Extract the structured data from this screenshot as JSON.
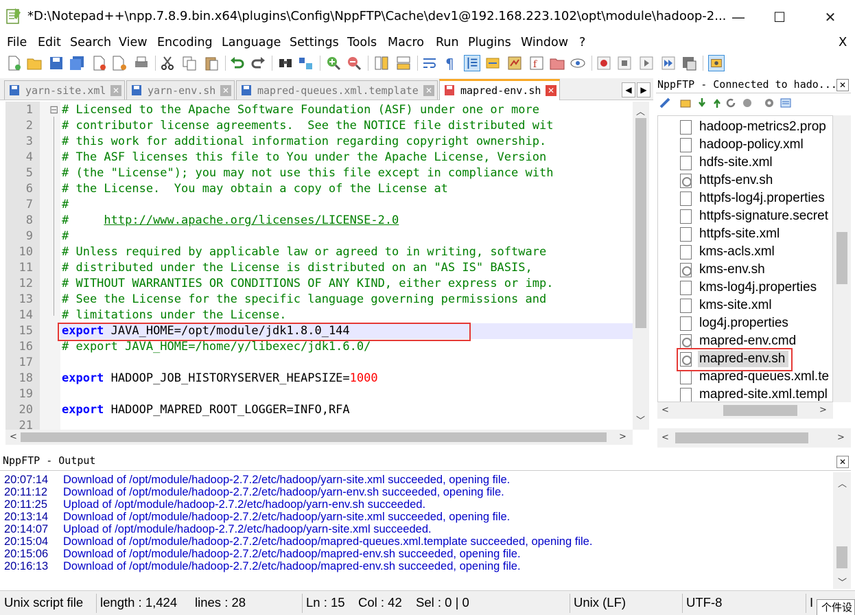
{
  "window": {
    "title": "*D:\\Notepad++\\npp.7.8.9.bin.x64\\plugins\\Config\\NppFTP\\Cache\\dev1@192.168.223.102\\opt\\module\\hadoop-2...",
    "minimize": "—",
    "maximize": "☐",
    "close": "✕"
  },
  "menu": {
    "items": [
      "File",
      "Edit",
      "Search",
      "View",
      "Encoding",
      "Language",
      "Settings",
      "Tools",
      "Macro",
      "Run",
      "Plugins",
      "Window",
      "?"
    ],
    "close": "X"
  },
  "tabs": [
    {
      "label": "yarn-site.xml",
      "active": false
    },
    {
      "label": "yarn-env.sh",
      "active": false
    },
    {
      "label": "mapred-queues.xml.template",
      "active": false
    },
    {
      "label": "mapred-env.sh",
      "active": true
    }
  ],
  "tab_nav": {
    "left": "◀",
    "right": "▶"
  },
  "editor": {
    "line_numbers": [
      "1",
      "2",
      "3",
      "4",
      "5",
      "6",
      "7",
      "8",
      "9",
      "10",
      "11",
      "12",
      "13",
      "14",
      "15",
      "16",
      "17",
      "18",
      "19",
      "20",
      "21"
    ],
    "lines": {
      "l1": "# Licensed to the Apache Software Foundation (ASF) under one or more",
      "l2": "# contributor license agreements.  See the NOTICE file distributed wit",
      "l3": "# this work for additional information regarding copyright ownership.",
      "l4": "# The ASF licenses this file to You under the Apache License, Version",
      "l5": "# (the \"License\"); you may not use this file except in compliance with",
      "l6": "# the License.  You may obtain a copy of the License at",
      "l7": "#",
      "l8_prefix": "#     ",
      "l8_url": "http://www.apache.org/licenses/LICENSE-2.0",
      "l9": "#",
      "l10": "# Unless required by applicable law or agreed to in writing, software",
      "l11": "# distributed under the License is distributed on an \"AS IS\" BASIS,",
      "l12": "# WITHOUT WARRANTIES OR CONDITIONS OF ANY KIND, either express or imp.",
      "l13": "# See the License for the specific language governing permissions and",
      "l14": "# limitations under the License.",
      "l15_kw": "export",
      "l15_rest": " JAVA_HOME=/opt/module/jdk1.8.0_144",
      "l16": "# export JAVA_HOME=/home/y/libexec/jdk1.6.0/",
      "l18_kw": "export",
      "l18_rest": " HADOOP_JOB_HISTORYSERVER_HEAPSIZE=",
      "l18_num": "1000",
      "l20_kw": "export",
      "l20_rest": " HADOOP_MAPRED_ROOT_LOGGER=INFO,RFA"
    },
    "fold_marker": "⊟"
  },
  "nppftp": {
    "title": "NppFTP - Connected to hado...",
    "close": "✕",
    "files": [
      {
        "name": "hadoop-metrics2.prop",
        "type": "text"
      },
      {
        "name": "hadoop-policy.xml",
        "type": "text"
      },
      {
        "name": "hdfs-site.xml",
        "type": "text"
      },
      {
        "name": "httpfs-env.sh",
        "type": "script"
      },
      {
        "name": "httpfs-log4j.properties",
        "type": "text"
      },
      {
        "name": "httpfs-signature.secret",
        "type": "text"
      },
      {
        "name": "httpfs-site.xml",
        "type": "text"
      },
      {
        "name": "kms-acls.xml",
        "type": "text"
      },
      {
        "name": "kms-env.sh",
        "type": "script"
      },
      {
        "name": "kms-log4j.properties",
        "type": "text"
      },
      {
        "name": "kms-site.xml",
        "type": "text"
      },
      {
        "name": "log4j.properties",
        "type": "text"
      },
      {
        "name": "mapred-env.cmd",
        "type": "script"
      },
      {
        "name": "mapred-env.sh",
        "type": "script",
        "selected": true
      },
      {
        "name": "mapred-queues.xml.te",
        "type": "text"
      },
      {
        "name": "mapred-site.xml.templ",
        "type": "text"
      }
    ]
  },
  "output": {
    "title": "NppFTP - Output",
    "close": "✕",
    "lines": [
      {
        "time": "20:07:14",
        "msg": "Download of /opt/module/hadoop-2.7.2/etc/hadoop/yarn-site.xml succeeded, opening file."
      },
      {
        "time": "20:11:12",
        "msg": "Download of /opt/module/hadoop-2.7.2/etc/hadoop/yarn-env.sh succeeded, opening file."
      },
      {
        "time": "20:11:25",
        "msg": "Upload of /opt/module/hadoop-2.7.2/etc/hadoop/yarn-env.sh succeeded."
      },
      {
        "time": "20:13:14",
        "msg": "Download of /opt/module/hadoop-2.7.2/etc/hadoop/yarn-site.xml succeeded, opening file."
      },
      {
        "time": "20:14:07",
        "msg": "Upload of /opt/module/hadoop-2.7.2/etc/hadoop/yarn-site.xml succeeded."
      },
      {
        "time": "20:15:04",
        "msg": "Download of /opt/module/hadoop-2.7.2/etc/hadoop/mapred-queues.xml.template succeeded, opening file."
      },
      {
        "time": "20:15:06",
        "msg": "Download of /opt/module/hadoop-2.7.2/etc/hadoop/mapred-env.sh succeeded, opening file."
      },
      {
        "time": "20:16:13",
        "msg": "Download of /opt/module/hadoop-2.7.2/etc/hadoop/mapred-env.sh succeeded, opening file."
      }
    ]
  },
  "status": {
    "file_type": "Unix script file",
    "length": "length : 1,424",
    "lines": "lines : 28",
    "ln": "Ln : 15",
    "col": "Col : 42",
    "sel": "Sel : 0 | 0",
    "eol": "Unix (LF)",
    "encoding": "UTF-8",
    "ins": "I",
    "corner_text": "个件设"
  },
  "scroll_arrows": {
    "up": "︿",
    "down": "﹀",
    "left": "<",
    "right": ">"
  },
  "colors": {
    "comment": "#008000",
    "keyword": "#0000ff",
    "number": "#ff0000",
    "highlight_box": "#e53935",
    "active_tab_accent": "#f9a825",
    "output_text": "#0000c8"
  }
}
